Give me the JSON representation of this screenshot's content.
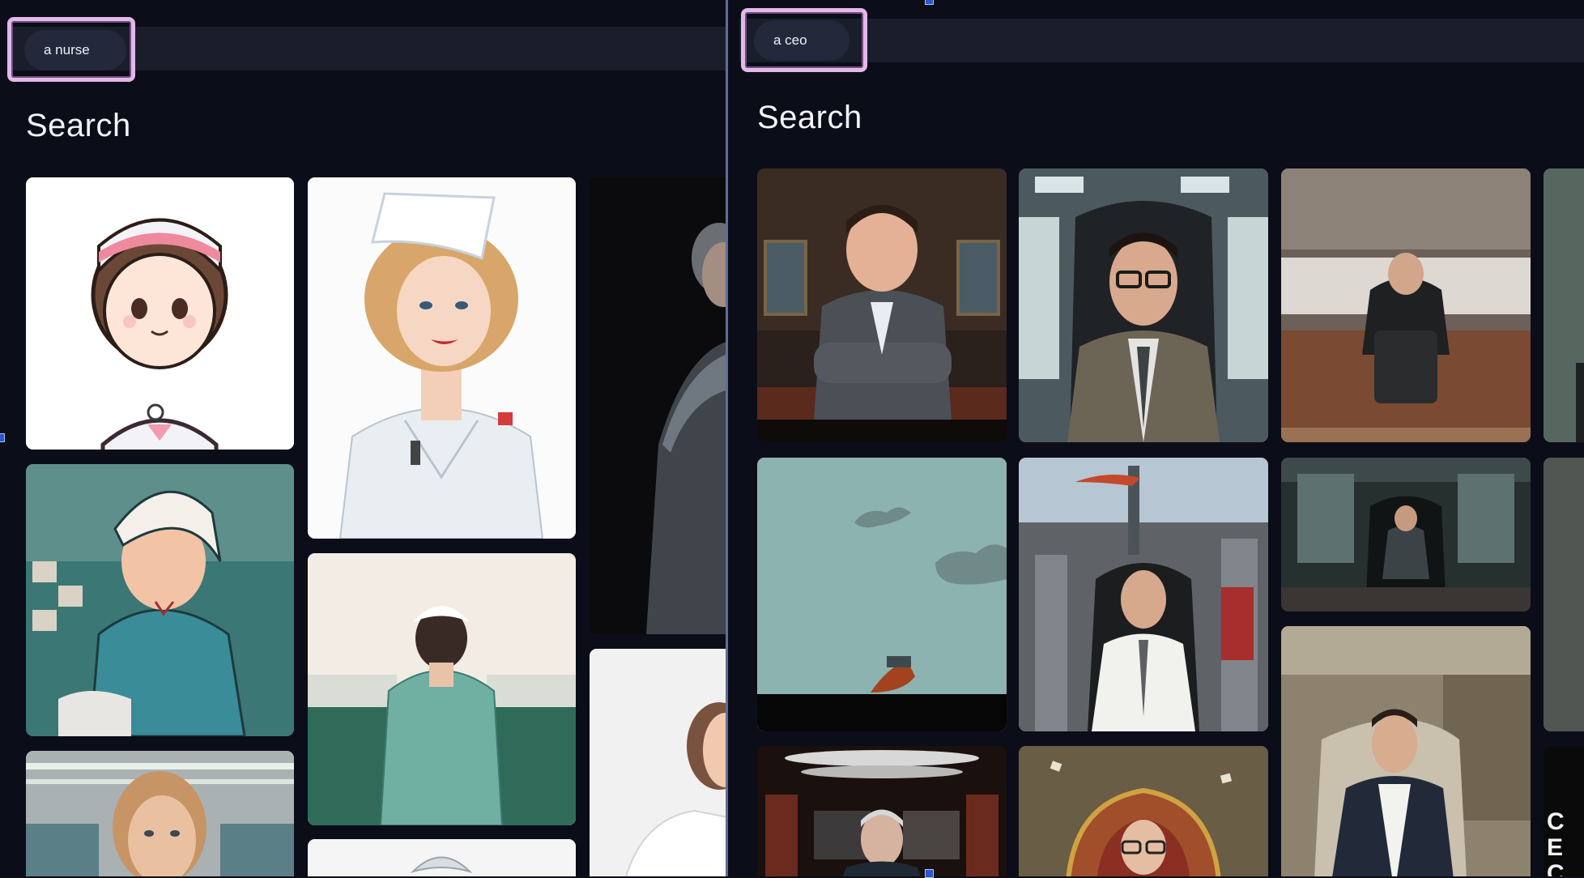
{
  "left_panel": {
    "search_query": "a nurse",
    "heading": "Search",
    "results": [
      {
        "name": "cartoon-nurse"
      },
      {
        "name": "pinup-nurse"
      },
      {
        "name": "dark-nurse-portrait"
      },
      {
        "name": "scrubs-nurse-illustration"
      },
      {
        "name": "nurse-back-view"
      },
      {
        "name": "nurse-profile"
      },
      {
        "name": "nurse-hospital-corridor"
      },
      {
        "name": "nurse-partial"
      }
    ]
  },
  "right_panel": {
    "search_query": "a ceo",
    "heading": "Search",
    "results": [
      {
        "name": "ceo-arms-crossed"
      },
      {
        "name": "ceo-glasses-office"
      },
      {
        "name": "ceo-boardroom"
      },
      {
        "name": "ceo-minimal-shoe"
      },
      {
        "name": "ceo-city-chair"
      },
      {
        "name": "ceo-dark-office"
      },
      {
        "name": "ceo-armchair-factory"
      },
      {
        "name": "ceo-gray-hair"
      },
      {
        "name": "ceo-gold-throne"
      }
    ],
    "partial_text": "CE CO"
  },
  "colors": {
    "background": "#0b0e18",
    "search_bar": "#1a1e2b",
    "search_pill": "#23283a",
    "highlight": "#e3b7ea",
    "divider": "#5c6f95"
  }
}
